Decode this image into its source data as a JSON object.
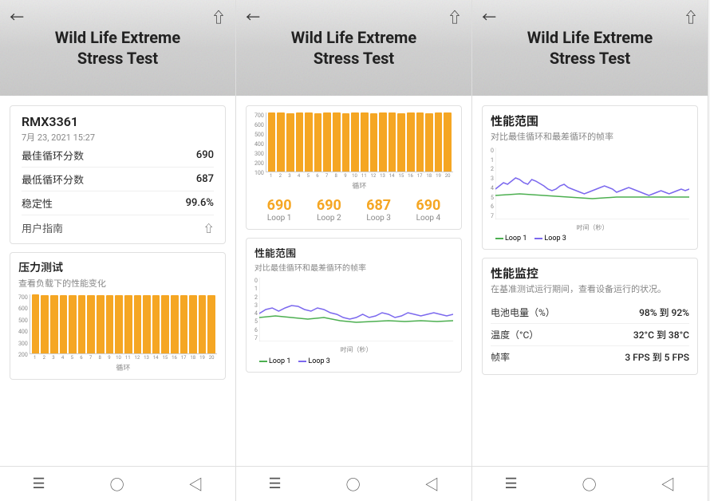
{
  "panels": [
    {
      "id": "panel-left",
      "header": {
        "title_line1": "Wild Life Extreme",
        "title_line2": "Stress Test"
      },
      "device": {
        "name": "RMX3361",
        "date": "7月 23, 2021 15:27"
      },
      "stats": [
        {
          "label": "最佳循环分数",
          "value": "690"
        },
        {
          "label": "最低循环分数",
          "value": "687"
        },
        {
          "label": "稳定性",
          "value": "99.6%"
        }
      ],
      "user_guide": "用户指南",
      "stress_section": {
        "title": "压力测试",
        "subtitle": "查看负载下的性能变化",
        "y_labels": [
          "700",
          "600",
          "500",
          "400",
          "300",
          "200"
        ],
        "x_label": "循环",
        "bars": [
          100,
          98,
          98,
          99,
          99,
          98,
          99,
          99,
          98,
          99,
          99,
          98,
          99,
          99,
          98,
          99,
          99,
          98,
          99,
          99
        ],
        "x_ticks": [
          "1",
          "2",
          "3",
          "4",
          "5",
          "6",
          "7",
          "8",
          "9",
          "10",
          "11",
          "12",
          "13",
          "14",
          "15",
          "16",
          "17",
          "18",
          "19",
          "20"
        ]
      }
    },
    {
      "id": "panel-middle",
      "header": {
        "title_line1": "Wild Life Extreme",
        "title_line2": "Stress Test"
      },
      "main_chart": {
        "y_labels": [
          "700",
          "600",
          "500",
          "400",
          "300",
          "200",
          "100"
        ],
        "x_label": "循环",
        "x_ticks": [
          "1",
          "2",
          "3",
          "4",
          "5",
          "6",
          "7",
          "8",
          "9",
          "10",
          "11",
          "12",
          "13",
          "14",
          "15",
          "16",
          "17",
          "18",
          "19",
          "20"
        ],
        "bar_height_pct": [
          100,
          100,
          99,
          100,
          100,
          99,
          100,
          100,
          99,
          100,
          100,
          99,
          100,
          100,
          99,
          100,
          100,
          99,
          100,
          100
        ]
      },
      "loops": [
        {
          "score": "690",
          "label": "Loop 1"
        },
        {
          "score": "690",
          "label": "Loop 2"
        },
        {
          "score": "687",
          "label": "Loop 3"
        },
        {
          "score": "690",
          "label": "Loop 4"
        }
      ],
      "perf_range": {
        "title": "性能范围",
        "subtitle": "对比最佳循环和最差循环的帧率",
        "y_labels": [
          "7",
          "6",
          "5",
          "4",
          "3",
          "2",
          "1",
          "0"
        ],
        "x_label": "时间（秒）",
        "legend": [
          "Loop 1",
          "Loop 3"
        ]
      }
    },
    {
      "id": "panel-right",
      "header": {
        "title_line1": "Wild Life Extreme",
        "title_line2": "Stress Test"
      },
      "perf_range": {
        "title": "性能范围",
        "subtitle": "对比最佳循环和最差循环的帧率",
        "y_labels": [
          "7",
          "6",
          "5",
          "4",
          "3",
          "2",
          "1",
          "0"
        ],
        "x_label": "时间（秒）",
        "legend_loop1": "Loop 1",
        "legend_loop3": "Loop 3"
      },
      "monitor": {
        "title": "性能监控",
        "subtitle": "在基准测试运行期间，查看设备运行的状况。",
        "rows": [
          {
            "label": "电池电量（%）",
            "value": "98% 到 92%"
          },
          {
            "label": "温度（°C）",
            "value": "32°C 到 38°C"
          },
          {
            "label": "帧率",
            "value": "3 FPS 到 5 FPS"
          }
        ]
      }
    }
  ],
  "nav": {
    "menu": "☰",
    "home": "○",
    "back": "◁"
  }
}
